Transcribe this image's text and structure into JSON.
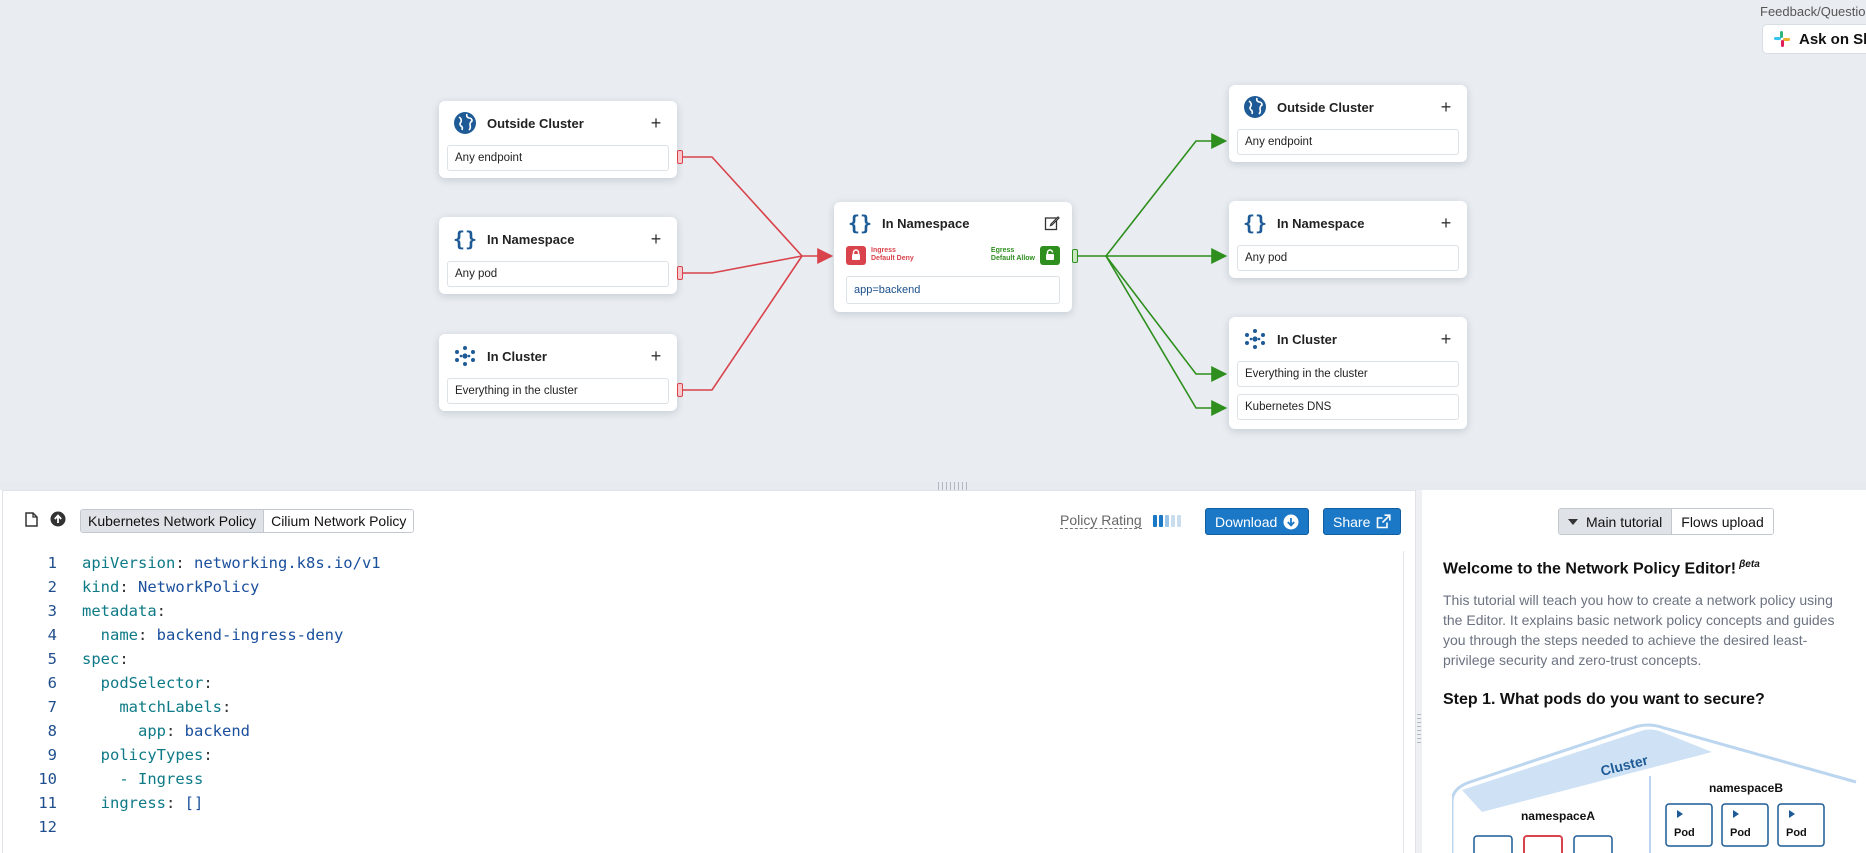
{
  "canvas": {
    "feedback_label": "Feedback/Questions?",
    "slack_button": "Ask on Slack",
    "ingress_sources": [
      {
        "title": "Outside Cluster",
        "icon": "globe-icon",
        "rows": [
          "Any endpoint"
        ]
      },
      {
        "title": "In Namespace",
        "icon": "braces-icon",
        "rows": [
          "Any pod"
        ]
      },
      {
        "title": "In Cluster",
        "icon": "cluster-icon",
        "rows": [
          "Everything in the cluster"
        ]
      }
    ],
    "center": {
      "title": "In Namespace",
      "ingress_label": "Ingress",
      "ingress_state": "Default Deny",
      "egress_label": "Egress",
      "egress_state": "Default Allow",
      "selector": "app=backend"
    },
    "egress_targets": [
      {
        "title": "Outside Cluster",
        "icon": "globe-icon",
        "rows": [
          "Any endpoint"
        ]
      },
      {
        "title": "In Namespace",
        "icon": "braces-icon",
        "rows": [
          "Any pod"
        ]
      },
      {
        "title": "In Cluster",
        "icon": "cluster-icon",
        "rows": [
          "Everything in the cluster",
          "Kubernetes DNS"
        ]
      }
    ],
    "colors": {
      "ingress": "#d9434b",
      "egress": "#2e8f1e",
      "brand_blue": "#1e5b96"
    }
  },
  "editor": {
    "tabs": [
      "Kubernetes Network Policy",
      "Cilium Network Policy"
    ],
    "active_tab": "Kubernetes Network Policy",
    "policy_rating_label": "Policy Rating",
    "policy_rating_level": 0.5,
    "download_label": "Download",
    "share_label": "Share",
    "code_lines": [
      {
        "num": "1",
        "key": "apiVersion",
        "value": "networking.k8s.io/v1",
        "indent": ""
      },
      {
        "num": "2",
        "key": "kind",
        "value": "NetworkPolicy",
        "indent": ""
      },
      {
        "num": "3",
        "key": "metadata",
        "value": "",
        "indent": ""
      },
      {
        "num": "4",
        "key": "name",
        "value": "backend-ingress-deny",
        "indent": "  "
      },
      {
        "num": "5",
        "key": "spec",
        "value": "",
        "indent": ""
      },
      {
        "num": "6",
        "key": "podSelector",
        "value": "",
        "indent": "  "
      },
      {
        "num": "7",
        "key": "matchLabels",
        "value": "",
        "indent": "    "
      },
      {
        "num": "8",
        "key": "app",
        "value": "backend",
        "indent": "      "
      },
      {
        "num": "9",
        "key": "policyTypes",
        "value": "",
        "indent": "  "
      },
      {
        "num": "10",
        "key": "",
        "value": "- Ingress",
        "indent": "    "
      },
      {
        "num": "11",
        "key": "ingress",
        "value": "[]",
        "indent": "  "
      },
      {
        "num": "12",
        "key": "",
        "value": "",
        "indent": ""
      }
    ]
  },
  "tutorial": {
    "tabs": [
      "Main tutorial",
      "Flows upload"
    ],
    "active_tab": "Main tutorial",
    "title": "Welcome to the Network Policy Editor!",
    "title_badge": "βeta",
    "body_lines": [
      "This tutorial will teach you how to create a network policy using",
      "the Editor. It explains basic network policy concepts and guides",
      "you through the steps needed to achieve the desired least-",
      "privilege security and zero-trust concepts."
    ],
    "step_title": "Step 1. What pods do you want to secure?",
    "diagram": {
      "cluster_label": "Cluster",
      "namespace_a": "namespaceA",
      "namespace_b": "namespaceB",
      "pod_label": "Pod"
    }
  }
}
